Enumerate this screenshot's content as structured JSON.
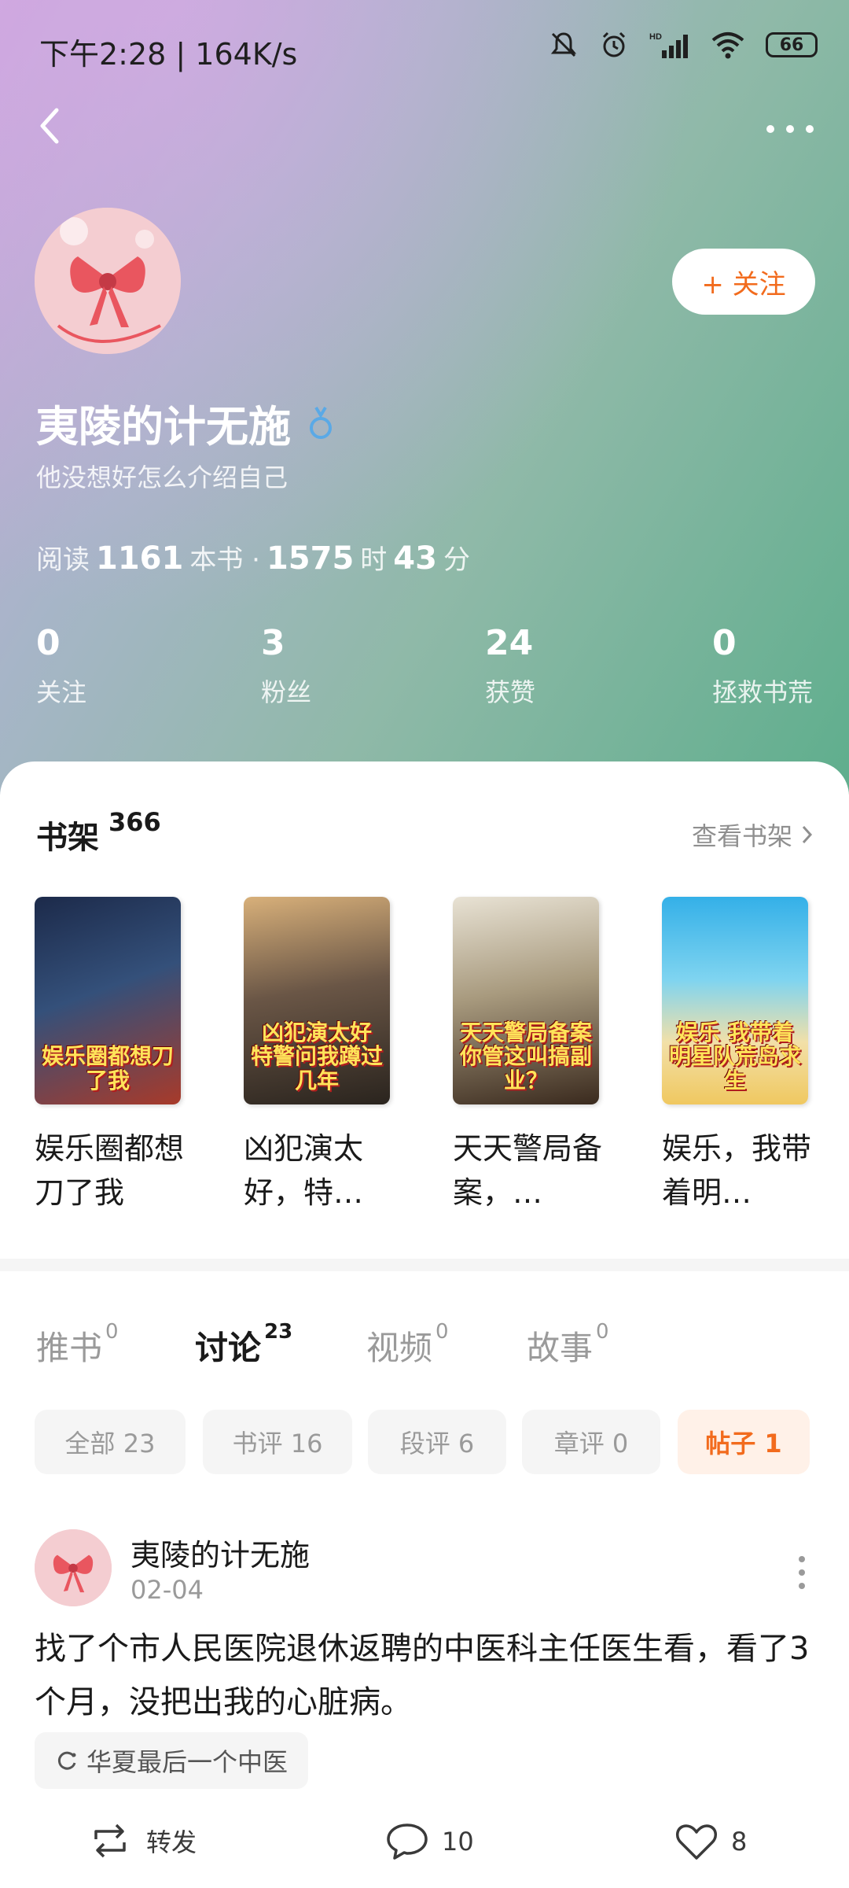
{
  "status_bar": {
    "time": "下午2:28 | 164K/s",
    "battery": "66",
    "icons": [
      "mute-icon",
      "alarm-icon",
      "hd-signal-icon",
      "wifi-icon",
      "battery-icon"
    ]
  },
  "header": {
    "back_icon": "back-chevron-icon",
    "more_icon": "more-dots-icon",
    "follow_label": "+ 关注"
  },
  "profile": {
    "name": "夷陵的计无施",
    "gender_icon": "male-icon",
    "bio": "他没想好怎么介绍自己",
    "reading": {
      "prefix": "阅读",
      "books": "1161",
      "books_unit": "本书 ·",
      "hours": "1575",
      "hours_unit": "时",
      "minutes": "43",
      "minutes_unit": "分"
    },
    "stats": [
      {
        "num": "0",
        "label": "关注"
      },
      {
        "num": "3",
        "label": "粉丝"
      },
      {
        "num": "24",
        "label": "获赞"
      },
      {
        "num": "0",
        "label": "拯救书荒"
      }
    ]
  },
  "bookshelf": {
    "title": "书架",
    "count": "366",
    "link": "查看书架",
    "books": [
      {
        "title": "娱乐圈都想刀了我",
        "cover_text": "娱乐圈都想刀了我",
        "bg": "#2a3550"
      },
      {
        "title": "凶犯演太好，特…",
        "cover_text": "凶犯演太好 特警问我蹲过几年",
        "bg": "#5a4a3a"
      },
      {
        "title": "天天警局备案，…",
        "cover_text": "天天警局备案 你管这叫搞副业？",
        "bg": "#8a7d68"
      },
      {
        "title": "娱乐，我带着明…",
        "cover_text": "娱乐 我带着明星队荒岛求生",
        "bg": "#3fa9d8"
      }
    ]
  },
  "tabs": [
    {
      "label": "推书",
      "count": "0"
    },
    {
      "label": "讨论",
      "count": "23"
    },
    {
      "label": "视频",
      "count": "0"
    },
    {
      "label": "故事",
      "count": "0"
    }
  ],
  "chips": [
    "全部 23",
    "书评 16",
    "段评 6",
    "章评 0",
    "帖子 1"
  ],
  "post": {
    "author": "夷陵的计无施",
    "date": "02-04",
    "body": "找了个市人民医院退休返聘的中医科主任医生看，看了3个月，没把出我的心脏病。",
    "topic": "华夏最后一个中医",
    "actions": [
      {
        "icon": "repost-icon",
        "label": "转发"
      },
      {
        "icon": "comment-icon",
        "label": "10"
      },
      {
        "icon": "like-icon",
        "label": "8"
      }
    ]
  },
  "colors": {
    "accent": "#f26b1d",
    "hero_start": "#c9a6dc",
    "hero_end": "#5fae8d"
  }
}
